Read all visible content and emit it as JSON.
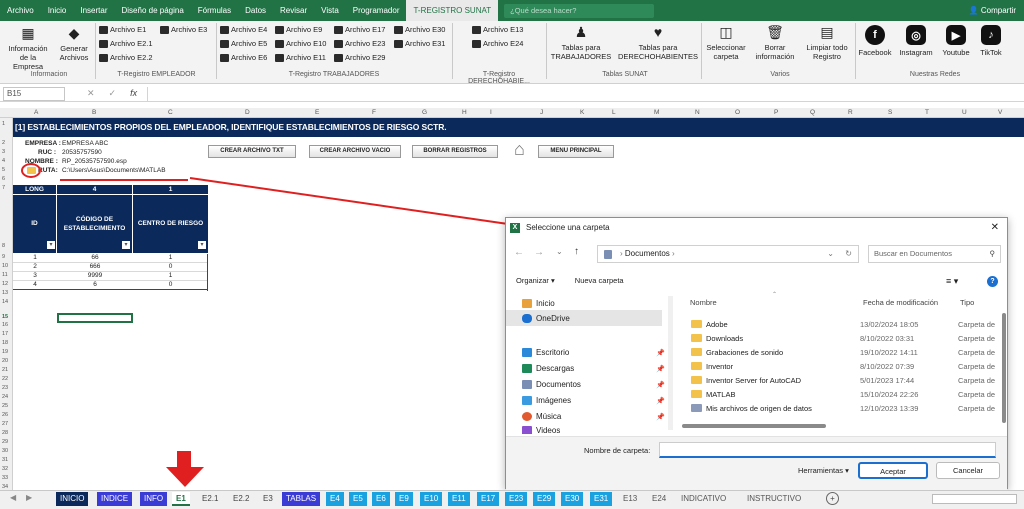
{
  "menu": {
    "items": [
      "Archivo",
      "Inicio",
      "Insertar",
      "Diseño de página",
      "Fórmulas",
      "Datos",
      "Revisar",
      "Vista",
      "Programador",
      "T-REGISTRO SUNAT"
    ],
    "search_placeholder": "¿Qué desea hacer?",
    "share": "Compartir"
  },
  "ribbon": {
    "info_button": "Información de la Empresa",
    "generate_button": "Generar Archivos",
    "group_info": "Informacion",
    "emp_files": [
      "Archivo E1",
      "Archivo E3",
      "Archivo E2.1",
      "Archivo E2.2"
    ],
    "group_emp": "T-Registro EMPLEADOR",
    "trab_files": [
      "Archivo E4",
      "Archivo E9",
      "Archivo E17",
      "Archivo E30",
      "Archivo E5",
      "Archivo E10",
      "Archivo E23",
      "Archivo E31",
      "Archivo E6",
      "Archivo E11",
      "Archivo E29"
    ],
    "group_trab": "T-Registro TRABAJADORES",
    "der_files": [
      "Archivo E13",
      "Archivo E24"
    ],
    "group_der": "T-Registro DERECHOHABIE...",
    "tablas_trab": "Tablas para TRABAJADORES",
    "tablas_der": "Tablas para DERECHOHABIENTES",
    "group_tablas": "Tablas SUNAT",
    "select_folder": "Seleccionar carpeta",
    "delete_info": "Borrar información",
    "clear_register": "Limpiar todo Registro",
    "group_varios": "Varios",
    "social": [
      "Facebook",
      "Instagram",
      "Youtube",
      "TikTok"
    ],
    "group_social": "Nuestras Redes"
  },
  "formula_bar": {
    "cell": "B15",
    "fx": "fx"
  },
  "columns": [
    "A",
    "B",
    "C",
    "D",
    "E",
    "F",
    "G",
    "H",
    "I",
    "J",
    "K",
    "L",
    "M",
    "N",
    "O",
    "P",
    "Q",
    "R",
    "S",
    "T",
    "U",
    "V"
  ],
  "sheet": {
    "banner": "[1] ESTABLECIMIENTOS PROPIOS DEL EMPLEADOR, IDENTIFIQUE ESTABLECIMIENTOS DE RIESGO SCTR.",
    "empresa_label": "EMPRESA :",
    "empresa": "EMPRESA ABC",
    "ruc_label": "RUC :",
    "ruc": "20535757590",
    "nombre_label": "NOMBRE :",
    "nombre": "RP_20535757590.esp",
    "ruta_label": "RUTA:",
    "ruta": "C:\\Users\\Asus\\Documents\\MATLAB",
    "buttons": [
      "CREAR ARCHIVO TXT",
      "CREAR ARCHIVO VACIO",
      "BORRAR REGISTROS",
      "MENU PRINCIPAL"
    ],
    "long_label": "LONG",
    "long_b": "4",
    "long_c": "1",
    "headers": [
      "ID",
      "CÓDIGO DE ESTABLECIMIENTO",
      "CENTRO DE RIESGO"
    ],
    "rows": [
      [
        "1",
        "66",
        "1"
      ],
      [
        "2",
        "666",
        "0"
      ],
      [
        "3",
        "9999",
        "1"
      ],
      [
        "4",
        "6",
        "0"
      ]
    ]
  },
  "dialog": {
    "title": "Seleccione una carpeta",
    "path": "Documentos",
    "search_placeholder": "Buscar en Documentos",
    "organize": "Organizar",
    "new_folder": "Nueva carpeta",
    "sidebar": [
      "Inicio",
      "OneDrive",
      "Escritorio",
      "Descargas",
      "Documentos",
      "Imágenes",
      "Música",
      "Videos"
    ],
    "col_name": "Nombre",
    "col_date": "Fecha de modificación",
    "col_type": "Tipo",
    "files": [
      {
        "name": "Adobe",
        "date": "13/02/2024 18:05",
        "type": "Carpeta de"
      },
      {
        "name": "Downloads",
        "date": "8/10/2022 03:31",
        "type": "Carpeta de"
      },
      {
        "name": "Grabaciones de sonido",
        "date": "19/10/2022 14:11",
        "type": "Carpeta de"
      },
      {
        "name": "Inventor",
        "date": "8/10/2022 07:39",
        "type": "Carpeta de"
      },
      {
        "name": "Inventor Server for AutoCAD",
        "date": "5/01/2023 17:44",
        "type": "Carpeta de"
      },
      {
        "name": "MATLAB",
        "date": "15/10/2024 22:26",
        "type": "Carpeta de"
      },
      {
        "name": "Mis archivos de origen de datos",
        "date": "12/10/2023 13:39",
        "type": "Carpeta de"
      }
    ],
    "folder_label": "Nombre de carpeta:",
    "tools": "Herramientas",
    "accept": "Aceptar",
    "cancel": "Cancelar"
  },
  "tabs": [
    {
      "label": "INICIO",
      "color": "#0b2a5b"
    },
    {
      "label": "INDICE",
      "color": "#3b3bd6"
    },
    {
      "label": "INFO",
      "color": "#3b3bd6"
    },
    {
      "label": "E1",
      "color": "#ffffff"
    },
    {
      "label": "E2.1",
      "color": "#7f7f7f"
    },
    {
      "label": "E2.2",
      "color": "#7f7f7f"
    },
    {
      "label": "E3",
      "color": "#7f7f7f"
    },
    {
      "label": "TABLAS",
      "color": "#3b3bd6"
    },
    {
      "label": "E4",
      "color": "#1aa1e0"
    },
    {
      "label": "E5",
      "color": "#1aa1e0"
    },
    {
      "label": "E6",
      "color": "#1aa1e0"
    },
    {
      "label": "E9",
      "color": "#1aa1e0"
    },
    {
      "label": "E10",
      "color": "#1aa1e0"
    },
    {
      "label": "E11",
      "color": "#1aa1e0"
    },
    {
      "label": "E17",
      "color": "#1aa1e0"
    },
    {
      "label": "E23",
      "color": "#1aa1e0"
    },
    {
      "label": "E29",
      "color": "#1aa1e0"
    },
    {
      "label": "E30",
      "color": "#1aa1e0"
    },
    {
      "label": "E31",
      "color": "#1aa1e0"
    },
    {
      "label": "E13",
      "color": "#7f7f7f"
    },
    {
      "label": "E24",
      "color": "#7f7f7f"
    },
    {
      "label": "INDICATIVO",
      "color": "#7f7f7f"
    },
    {
      "label": "INSTRUCTIVO",
      "color": "#7f7f7f"
    }
  ]
}
